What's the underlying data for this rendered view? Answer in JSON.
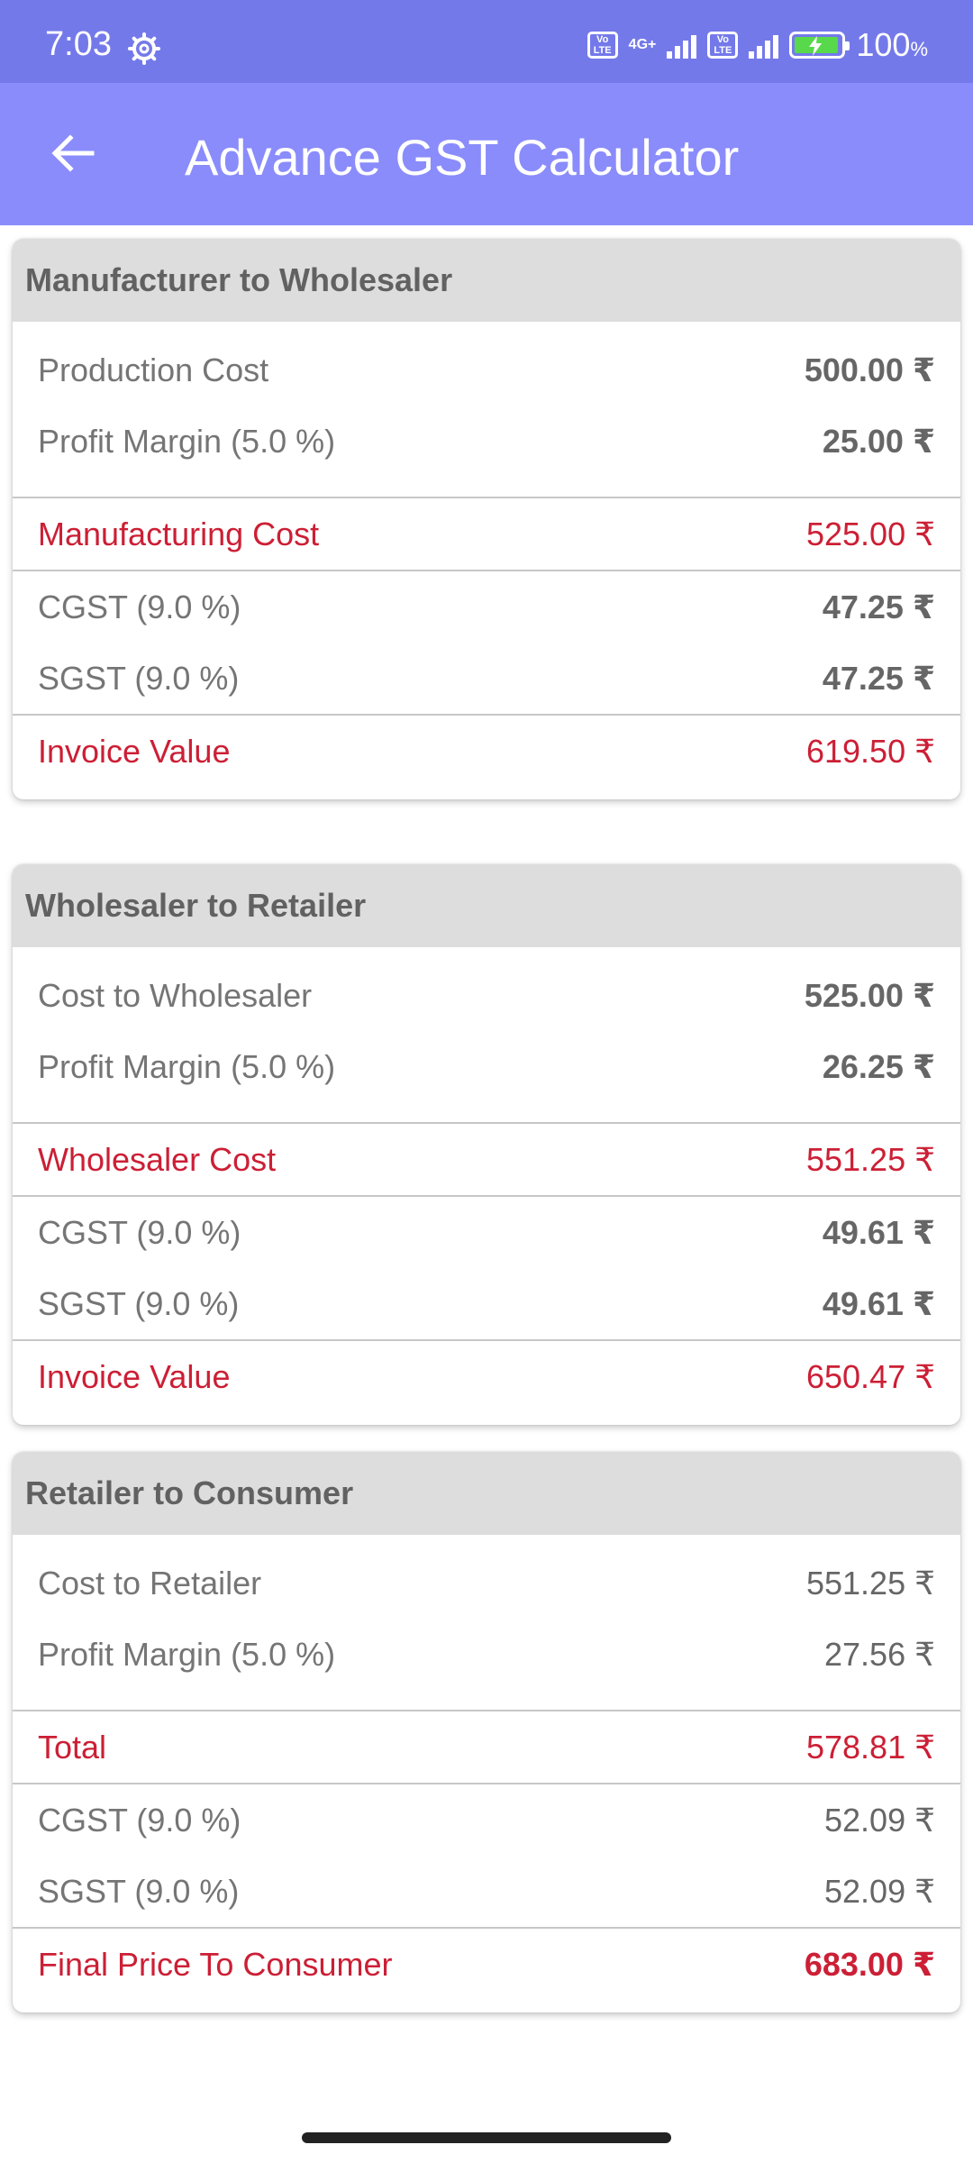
{
  "status_bar": {
    "time": "7:03",
    "network_type": "4G+",
    "volte_label": "Vo LTE",
    "battery_percent": "100",
    "battery_unit": "%"
  },
  "app_bar": {
    "title": "Advance GST Calculator"
  },
  "sections": [
    {
      "title": "Manufacturer to Wholesaler",
      "base_label": "Production Cost",
      "base_value": "500.00 ₹",
      "margin_label": "Profit Margin (5.0 %)",
      "margin_value": "25.00 ₹",
      "subtotal_label": "Manufacturing Cost",
      "subtotal_value": "525.00 ₹",
      "cgst_label": "CGST (9.0 %)",
      "cgst_value": "47.25 ₹",
      "sgst_label": "SGST (9.0 %)",
      "sgst_value": "47.25 ₹",
      "total_label": "Invoice Value",
      "total_value": "619.50 ₹"
    },
    {
      "title": "Wholesaler to Retailer",
      "base_label": "Cost to Wholesaler",
      "base_value": "525.00 ₹",
      "margin_label": "Profit Margin (5.0 %)",
      "margin_value": "26.25 ₹",
      "subtotal_label": "Wholesaler Cost",
      "subtotal_value": "551.25 ₹",
      "cgst_label": "CGST (9.0 %)",
      "cgst_value": "49.61 ₹",
      "sgst_label": "SGST (9.0 %)",
      "sgst_value": "49.61 ₹",
      "total_label": "Invoice Value",
      "total_value": "650.47 ₹"
    },
    {
      "title": "Retailer to Consumer",
      "base_label": "Cost to Retailer",
      "base_value": "551.25 ₹",
      "margin_label": "Profit Margin (5.0 %)",
      "margin_value": "27.56 ₹",
      "subtotal_label": "Total",
      "subtotal_value": "578.81 ₹",
      "cgst_label": "CGST (9.0 %)",
      "cgst_value": "52.09 ₹",
      "sgst_label": "SGST (9.0 %)",
      "sgst_value": "52.09 ₹",
      "total_label": "Final Price To Consumer",
      "total_value": "683.00 ₹"
    }
  ],
  "colors": {
    "status_bar": "#7479ea",
    "app_bar": "#8a8cfb",
    "accent_red": "#cc1f35",
    "card_header_bg": "#dddddd"
  },
  "icons": {
    "back": "arrow-left-icon",
    "settings": "gear-icon"
  }
}
